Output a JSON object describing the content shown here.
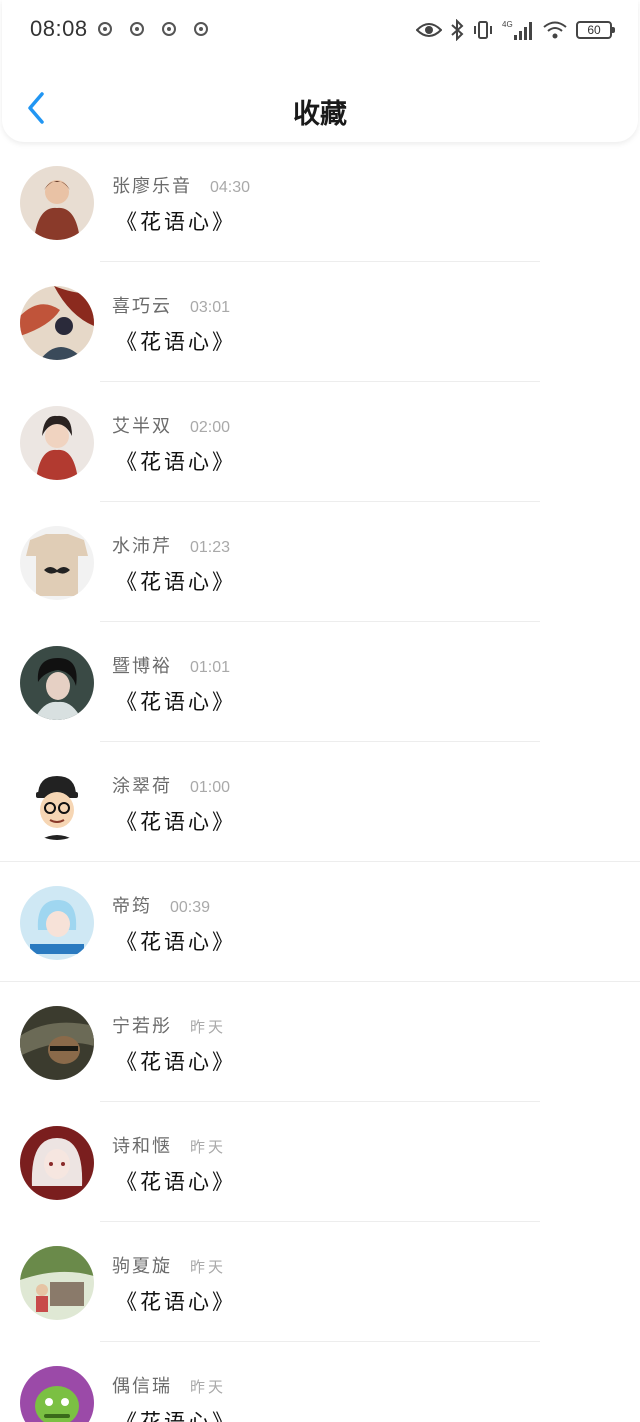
{
  "status_bar": {
    "time": "08:08",
    "battery": "60",
    "network": "4G"
  },
  "nav": {
    "title": "收藏",
    "back_icon": "chevron-left-icon",
    "accent_color": "#2196f3"
  },
  "items": [
    {
      "name": "张廖乐音",
      "time": "04:30",
      "title": "《花语心》",
      "avatar_color": "#8a3a2a"
    },
    {
      "name": "喜巧云",
      "time": "03:01",
      "title": "《花语心》",
      "avatar_color": "#c0543a"
    },
    {
      "name": "艾半双",
      "time": "02:00",
      "title": "《花语心》",
      "avatar_color": "#b23a30"
    },
    {
      "name": "水沛芹",
      "time": "01:23",
      "title": "《花语心》",
      "avatar_color": "#e0cdb6"
    },
    {
      "name": "暨博裕",
      "time": "01:01",
      "title": "《花语心》",
      "avatar_color": "#3a4a45"
    },
    {
      "name": "涂翠荷",
      "time": "01:00",
      "title": "《花语心》",
      "avatar_color": "#ffffff"
    },
    {
      "name": "帝筠",
      "time": "00:39",
      "title": "《花语心》",
      "avatar_color": "#9fd6f0"
    },
    {
      "name": "宁若彤",
      "time": "昨天",
      "title": "《花语心》",
      "avatar_color": "#3b3b2e"
    },
    {
      "name": "诗和惬",
      "time": "昨天",
      "title": "《花语心》",
      "avatar_color": "#7a1e1e"
    },
    {
      "name": "驹夏旋",
      "time": "昨天",
      "title": "《花语心》",
      "avatar_color": "#6a8a4a"
    },
    {
      "name": "偶信瑞",
      "time": "昨天",
      "title": "《花语心》",
      "avatar_color": "#9b4aa8"
    }
  ]
}
